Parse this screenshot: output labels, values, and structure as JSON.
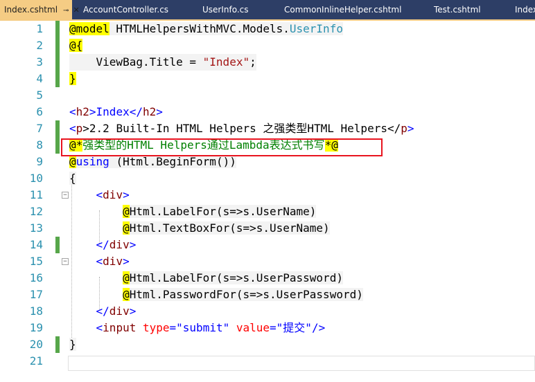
{
  "tabs": [
    {
      "label": "Index.cshtml",
      "active": true
    },
    {
      "label": "AccountController.cs",
      "active": false
    },
    {
      "label": "UserInfo.cs",
      "active": false
    },
    {
      "label": "CommonInlineHelper.cshtml",
      "active": false
    },
    {
      "label": "Test.cshtml",
      "active": false
    },
    {
      "label": "Index",
      "active": false
    }
  ],
  "tab_icons": {
    "pin": "pin-icon",
    "close": "close-icon"
  },
  "colors": {
    "tabbar_bg": "#2d3e66",
    "active_tab": "#f5cc84",
    "line_number": "#2b91af",
    "keyword": "#0000ff",
    "string": "#a31515",
    "tag": "#800000",
    "attribute": "#ff0000",
    "comment": "#008000",
    "razor_highlight": "#ffff00",
    "change_marker": "#57a64a",
    "annotation_box": "#e8141f"
  },
  "lines": {
    "l1": {
      "num": "1",
      "a": "@model",
      "b": " HTMLHelpersWithMVC.Models.",
      "c": "UserInfo"
    },
    "l2": {
      "num": "2",
      "a": "@{"
    },
    "l3": {
      "num": "3",
      "a": "    ViewBag.Title = ",
      "b": "\"Index\"",
      "c": ";"
    },
    "l4": {
      "num": "4",
      "a": "}"
    },
    "l5": {
      "num": "5"
    },
    "l6": {
      "num": "6",
      "a": "<",
      "b": "h2",
      "c": ">Index</",
      "d": "h2",
      "e": ">"
    },
    "l7": {
      "num": "7",
      "a": "<",
      "b": "p",
      "c": ">2.2 Built-In HTML Helpers 之强类型HTML Helpers</",
      "d": "p",
      "e": ">"
    },
    "l8": {
      "num": "8",
      "a": "@*",
      "b": "强类型的HTML Helpers通过Lambda表达式书写",
      "c": "*@"
    },
    "l9": {
      "num": "9",
      "a": "@",
      "b": "using",
      "c": " (Html.BeginForm())"
    },
    "l10": {
      "num": "10",
      "a": "{"
    },
    "l11": {
      "num": "11",
      "a": "<",
      "b": "div",
      "c": ">"
    },
    "l12": {
      "num": "12",
      "a": "@",
      "b": "Html.LabelFor(s=>s.UserName)"
    },
    "l13": {
      "num": "13",
      "a": "@",
      "b": "Html.TextBoxFor(s=>s.UserName)"
    },
    "l14": {
      "num": "14",
      "a": "</",
      "b": "div",
      "c": ">"
    },
    "l15": {
      "num": "15",
      "a": "<",
      "b": "div",
      "c": ">"
    },
    "l16": {
      "num": "16",
      "a": "@",
      "b": "Html.LabelFor(s=>s.UserPassword)"
    },
    "l17": {
      "num": "17",
      "a": "@",
      "b": "Html.PasswordFor(s=>s.UserPassword)"
    },
    "l18": {
      "num": "18",
      "a": "</",
      "b": "div",
      "c": ">"
    },
    "l19": {
      "num": "19",
      "a": "<",
      "b": "input",
      "c": " ",
      "d": "type",
      "e": "=",
      "f": "\"submit\"",
      "g": " ",
      "h": "value",
      "i": "=",
      "j": "\"提交\"",
      "k": "/>"
    },
    "l20": {
      "num": "20",
      "a": "}"
    },
    "l21": {
      "num": "21"
    }
  },
  "fold_glyph": "−"
}
